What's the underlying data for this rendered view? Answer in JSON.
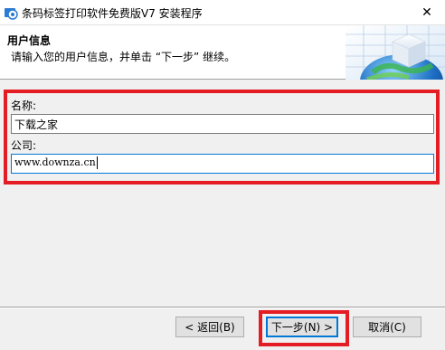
{
  "window": {
    "title": "条码标签打印软件免费版V7 安装程序",
    "close_glyph": "✕"
  },
  "header": {
    "title": "用户信息",
    "subtitle": "请输入您的用户信息，并单击 “下一步” 继续。"
  },
  "form": {
    "name_label": "名称:",
    "name_value": "下载之家",
    "company_label": "公司:",
    "company_value": "www.downza.cn"
  },
  "buttons": {
    "back": "< 返回(B)",
    "next": "下一步(N) >",
    "cancel": "取消(C)"
  },
  "colors": {
    "highlight": "#e41c24",
    "focus": "#0078d7"
  },
  "icons": {
    "app": "installer-icon",
    "header": "globe-cube-icon"
  }
}
